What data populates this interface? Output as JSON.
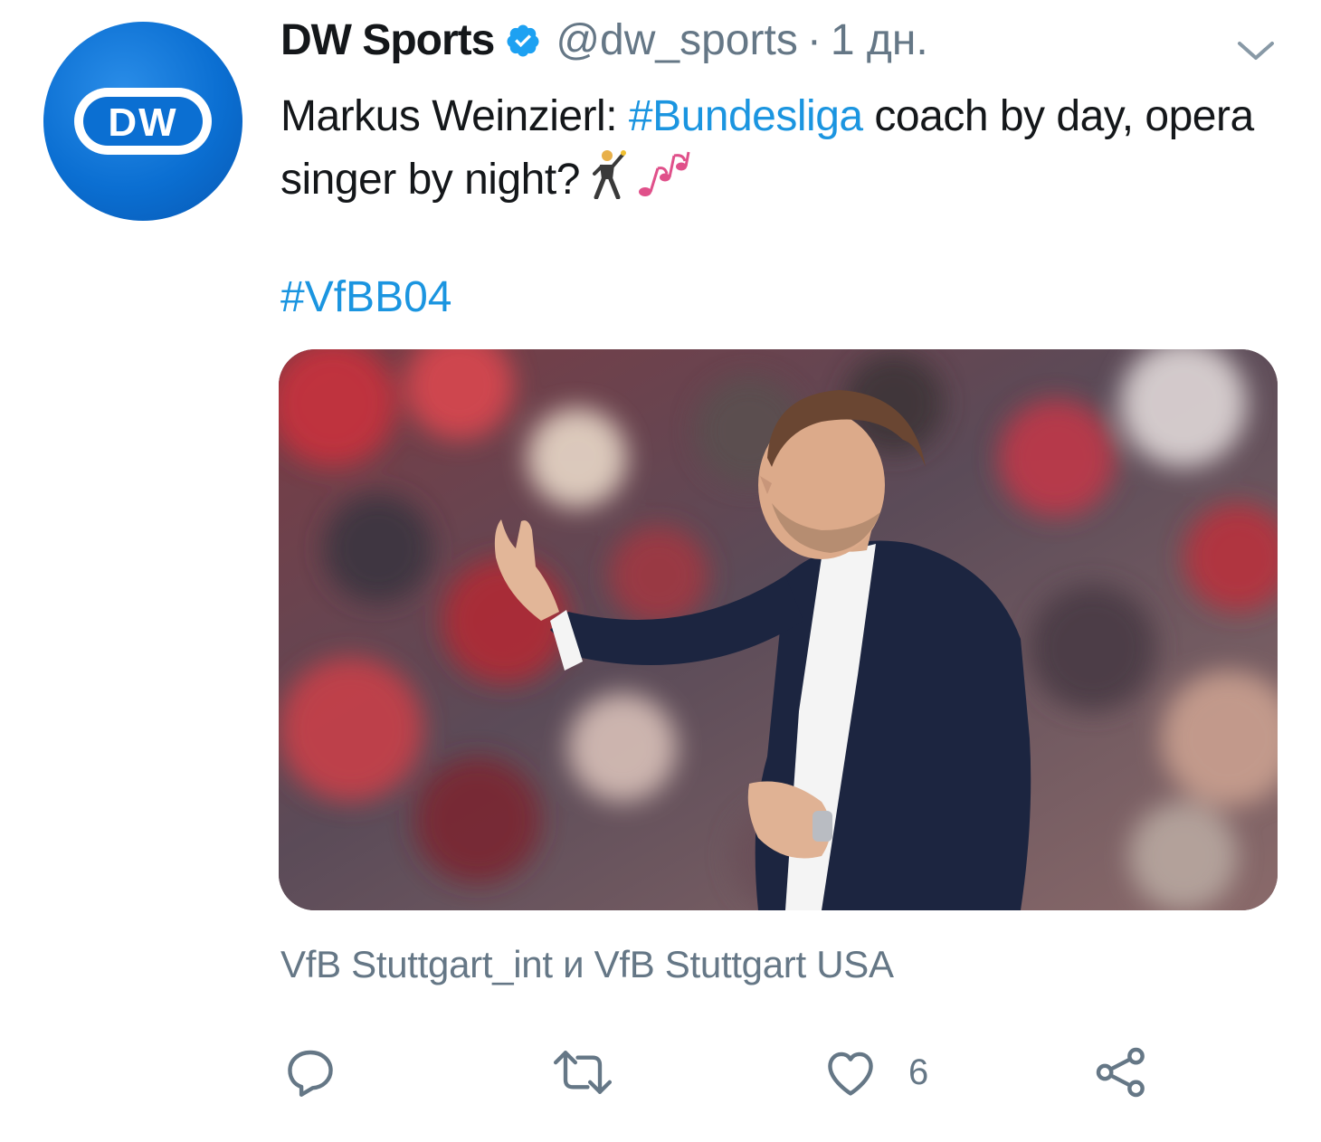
{
  "tweet": {
    "author": {
      "display_name": "DW Sports",
      "handle": "@dw_sports",
      "verified": true,
      "avatar_text": "DW"
    },
    "separator": "·",
    "timestamp": "1 дн.",
    "text": {
      "part1": "Markus Weinzierl: ",
      "hashtag1": "#Bundesliga",
      "part2": " coach by day, opera singer by night?",
      "emojis": [
        "man-dancing-icon",
        "musical-notes-icon"
      ]
    },
    "hashtag2": "#VfBB04",
    "media": {
      "image": "photo of a coach in a dark suit gesturing on the touchline with a blurred crowd behind"
    },
    "tagged_users": "VfB Stuttgart_int и VfB Stuttgart USA",
    "actions": {
      "reply": {
        "icon": "reply-icon"
      },
      "retweet": {
        "icon": "retweet-icon"
      },
      "like": {
        "icon": "heart-icon",
        "count": "6"
      },
      "share": {
        "icon": "share-icon"
      }
    }
  },
  "colors": {
    "link": "#1b95e0",
    "secondary_text": "#657786",
    "primary_text": "#14171a",
    "avatar_blue": "#0b6fd2"
  }
}
